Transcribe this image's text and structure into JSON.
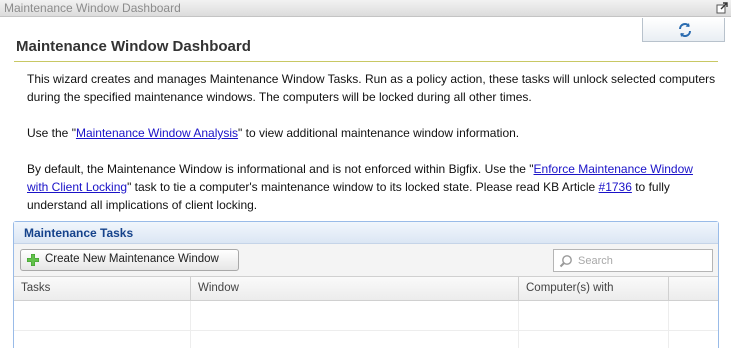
{
  "window": {
    "title": "Maintenance Window Dashboard"
  },
  "page": {
    "title": "Maintenance Window Dashboard"
  },
  "intro": {
    "p1": "This wizard creates and manages Maintenance Window Tasks. Run as a policy action, these tasks will unlock selected computers during the specified maintenance windows. The computers will be locked during all other times.",
    "p2_before": "Use the \"",
    "p2_link": "Maintenance Window Analysis",
    "p2_after": "\" to view additional maintenance window information.",
    "p3_before": "By default, the Maintenance Window is informational and is not enforced within Bigfix. Use the \"",
    "p3_link": "Enforce Maintenance Window with Client Locking",
    "p3_middle": "\" task to tie a computer's maintenance window to its locked state. Please read KB Article ",
    "p3_link2": "#1736",
    "p3_after": " to fully understand all implications of client locking."
  },
  "panel": {
    "title": "Maintenance Tasks",
    "create_button": "Create New Maintenance Window",
    "search_placeholder": "Search",
    "columns": [
      "Tasks",
      "Window",
      "Computer(s) with"
    ]
  },
  "icons": {
    "popout": "popout-icon",
    "refresh": "refresh-icon",
    "add": "plus-icon",
    "search": "magnifier-icon"
  },
  "colors": {
    "link": "#1a12c8",
    "panel_title": "#15428b",
    "panel_border": "#99bbe8",
    "title_rule": "#c8c864"
  }
}
